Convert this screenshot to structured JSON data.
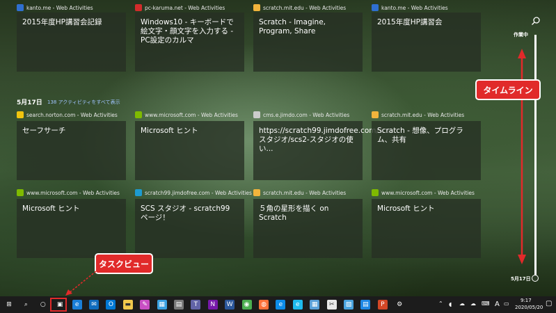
{
  "groups": [
    {
      "date": "",
      "show_all": "",
      "cards": [
        {
          "source": "kanto.me - Web Activities",
          "title": "2015年度HP講習会記録",
          "icon": "kanto-site-icon",
          "color": "#2f6fd0"
        },
        {
          "source": "pc-karuma.net - Web Activities",
          "title": "Windows10 - キーボードで絵文字・顔文字を入力する - PC設定のカルマ",
          "icon": "karuma-site-icon",
          "color": "#d22b2b"
        },
        {
          "source": "scratch.mit.edu - Web Activities",
          "title": "Scratch - Imagine, Program, Share",
          "icon": "scratch-site-icon",
          "color": "#f2b43c"
        },
        {
          "source": "kanto.me - Web Activities",
          "title": "2015年度HP講習会",
          "icon": "kanto-site-icon",
          "color": "#2f6fd0"
        }
      ]
    },
    {
      "date": "5月17日",
      "show_all": "138 アクティビティをすべて表示",
      "cards": [
        {
          "source": "search.norton.com - Web Activities",
          "title": "セーフサーチ",
          "icon": "norton-site-icon",
          "color": "#f1c40f"
        },
        {
          "source": "www.microsoft.com - Web Activities",
          "title": "Microsoft ヒント",
          "icon": "microsoft-site-icon",
          "color": "#7fba00"
        },
        {
          "source": "cms.e.jimdo.com - Web Activities",
          "title": "https://scratch99.jimdofree.com/scs-スタジオ/scs2-スタジオの使い...",
          "icon": "jimdo-site-icon",
          "color": "#cccccc"
        },
        {
          "source": "scratch.mit.edu - Web Activities",
          "title": "Scratch - 想像、プログラム、共有",
          "icon": "scratch-site-icon",
          "color": "#f2b43c"
        }
      ]
    },
    {
      "date": "",
      "show_all": "",
      "cards": [
        {
          "source": "www.microsoft.com - Web Activities",
          "title": "Microsoft ヒント",
          "icon": "microsoft-site-icon",
          "color": "#7fba00"
        },
        {
          "source": "scratch99.jimdofree.com - Web Activities",
          "title": "SCS スタジオ - scratch99 ページ！",
          "icon": "jimdo-site-icon",
          "color": "#1d9bd1"
        },
        {
          "source": "scratch.mit.edu - Web Activities",
          "title": "５角の星形を描く on Scratch",
          "icon": "scratch-site-icon",
          "color": "#f2b43c"
        },
        {
          "source": "www.microsoft.com - Web Activities",
          "title": "Microsoft ヒント",
          "icon": "microsoft-site-icon",
          "color": "#7fba00"
        }
      ]
    }
  ],
  "timeline": {
    "top_label": "作業中",
    "bottom_label": "5月17日",
    "search_icon": "search-icon"
  },
  "callouts": {
    "timeline": "タイムライン",
    "taskview": "タスクビュー"
  },
  "taskbar": {
    "accent": "#e12a2a",
    "apps": [
      "start-icon",
      "search-icon",
      "cortana-icon",
      "task-view-icon",
      "edge-legacy-icon",
      "mail-icon",
      "outlook-icon",
      "explorer-icon",
      "paint-icon",
      "photos-icon",
      "calculator-icon",
      "teams-icon",
      "onenote-icon",
      "word-icon",
      "chrome-icon",
      "firefox-icon",
      "edge-icon",
      "ie-icon",
      "photo-viewer-icon",
      "snip-icon",
      "image-icon",
      "store-icon",
      "powerpoint-icon",
      "settings-icon"
    ],
    "tray": {
      "ime": "A",
      "time": "9:17",
      "date": "2020/05/20"
    }
  }
}
